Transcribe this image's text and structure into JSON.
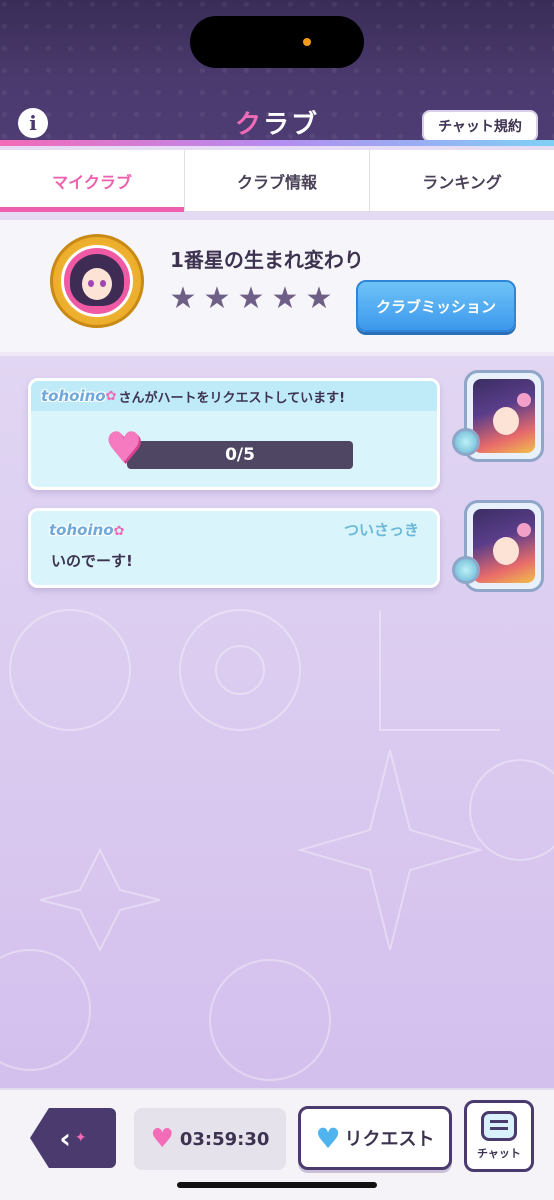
{
  "header": {
    "title_accent": "ク",
    "title_rest": "ラブ",
    "chat_rules_label": "チャット規約",
    "info_icon": "i"
  },
  "tabs": [
    {
      "label": "マイクラブ",
      "active": true
    },
    {
      "label": "クラブ情報",
      "active": false
    },
    {
      "label": "ランキング",
      "active": false
    }
  ],
  "club": {
    "name": "1番星の生まれ変わり",
    "stars": [
      "★",
      "★",
      "★",
      "★",
      "★"
    ],
    "mission_button_label": "クラブミッション"
  },
  "messages": [
    {
      "username": "tohoino",
      "text": "さんがハートをリクエストしています!",
      "progress_text": "0/5",
      "progress_current": 0,
      "progress_total": 5
    },
    {
      "username": "tohoino",
      "timestamp": "ついさっき",
      "text": "いのでーす!"
    }
  ],
  "bottom_bar": {
    "timer": "03:59:30",
    "request_label": "リクエスト",
    "chat_label": "チャット"
  },
  "colors": {
    "accent_pink": "#ee5fae",
    "header_purple": "#4a3a6e",
    "mission_blue": "#3d98ec",
    "bubble_cyan": "#d9f5fb"
  }
}
